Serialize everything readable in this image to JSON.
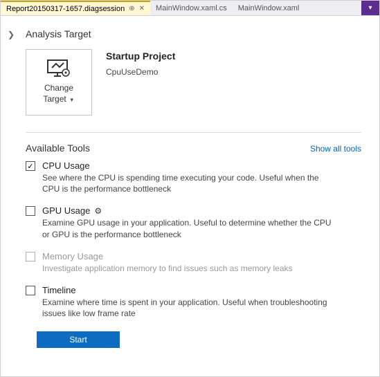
{
  "tabs": [
    {
      "label": "Report20150317-1657.diagsession",
      "active": true
    },
    {
      "label": "MainWindow.xaml.cs",
      "active": false
    },
    {
      "label": "MainWindow.xaml",
      "active": false
    }
  ],
  "analysis": {
    "section_title": "Analysis Target",
    "change_target_label": "Change Target",
    "startup_title": "Startup Project",
    "startup_name": "CpuUseDemo"
  },
  "tools_section": {
    "title": "Available Tools",
    "show_all": "Show all tools"
  },
  "tools": [
    {
      "name": "CPU Usage",
      "desc": "See where the CPU is spending time executing your code. Useful when the CPU is the performance bottleneck",
      "checked": true,
      "disabled": false,
      "gear": false
    },
    {
      "name": "GPU Usage",
      "desc": "Examine GPU usage in your application. Useful to determine whether the CPU or GPU is the performance bottleneck",
      "checked": false,
      "disabled": false,
      "gear": true
    },
    {
      "name": "Memory Usage",
      "desc": "Investigate application memory to find issues such as memory leaks",
      "checked": false,
      "disabled": true,
      "gear": false
    },
    {
      "name": "Timeline",
      "desc": "Examine where time is spent in your application. Useful when troubleshooting issues like low frame rate",
      "checked": false,
      "disabled": false,
      "gear": false
    }
  ],
  "start_label": "Start"
}
